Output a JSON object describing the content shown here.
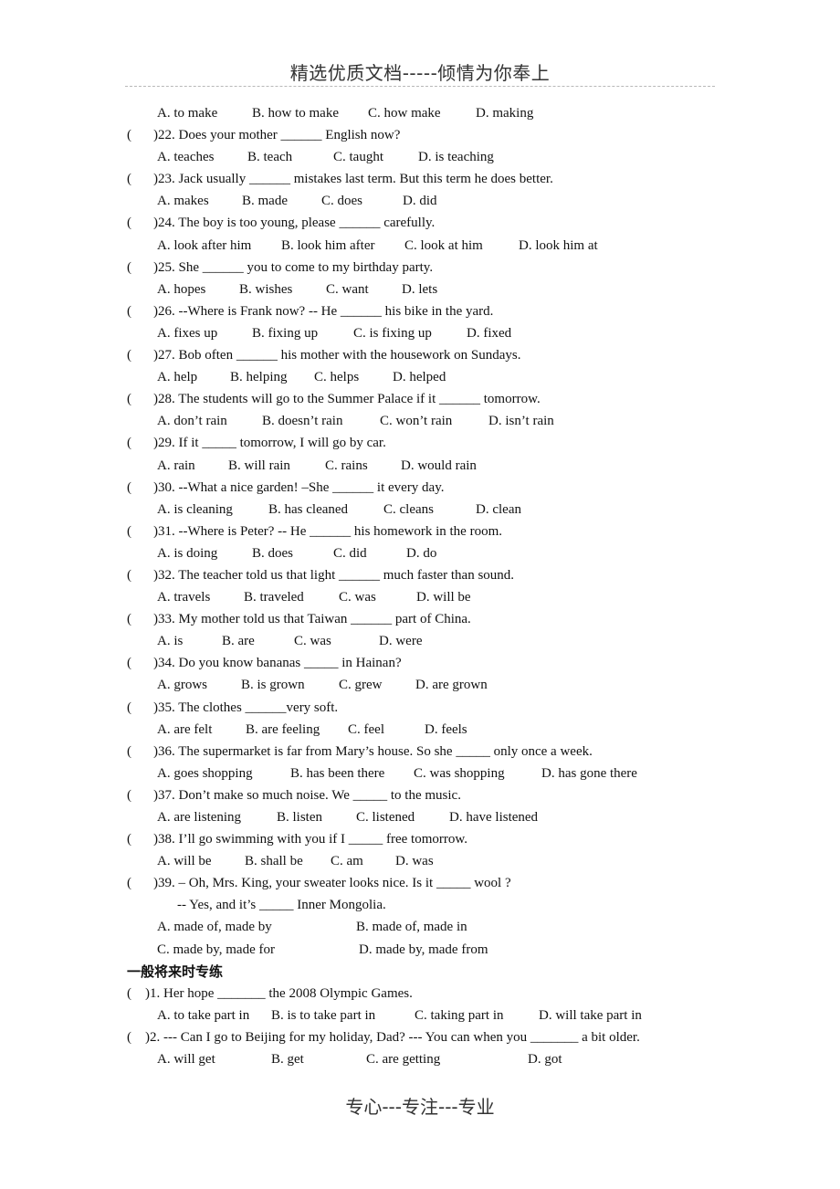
{
  "header": {
    "title": "精选优质文档-----倾情为你奉上"
  },
  "footer": {
    "text": "专心---专注---专业"
  },
  "leading_options": [
    "A. to make",
    "B. how to make",
    "C. how make",
    "D. making"
  ],
  "questions": [
    {
      "num": "22",
      "text": ")22. Does your mother   ______ English now?",
      "options": [
        "A. teaches",
        "B. teach",
        "C. taught",
        "D. is teaching"
      ]
    },
    {
      "num": "23",
      "text": ")23. Jack usually ______ mistakes last term. But this term he does better.",
      "options": [
        "A. makes",
        "B. made",
        "C. does",
        "D. did"
      ]
    },
    {
      "num": "24",
      "text": ")24. The boy is too young, please ______ carefully.",
      "options": [
        "A. look after him",
        "B. look him after",
        "C. look at him",
        "D. look him at"
      ]
    },
    {
      "num": "25",
      "text": ")25. She ______ you to come to my birthday party.",
      "options": [
        "A. hopes",
        "B. wishes",
        "C. want",
        "D. lets"
      ]
    },
    {
      "num": "26",
      "text": ")26. --Where is Frank now?    -- He ______ his bike in the yard.",
      "options": [
        "A. fixes up",
        "B. fixing up",
        "C. is fixing up",
        "D. fixed"
      ]
    },
    {
      "num": "27",
      "text": ")27. Bob often ______ his mother with the housework on Sundays.",
      "options": [
        "A. help",
        "B. helping",
        "C. helps",
        "D. helped"
      ]
    },
    {
      "num": "28",
      "text": ")28. The students will go to the Summer Palace if it ______ tomorrow.",
      "options": [
        "A. don’t rain",
        "B. doesn’t rain",
        "C. won’t rain",
        "D. isn’t rain"
      ]
    },
    {
      "num": "29",
      "text": ")29. If it _____ tomorrow, I will go by car.",
      "options": [
        "A. rain",
        "B. will rain",
        "C. rains",
        "D. would rain"
      ]
    },
    {
      "num": "30",
      "text": ")30. --What a nice garden! –She ______ it every day.",
      "options": [
        "A. is cleaning",
        "B. has cleaned",
        "C. cleans",
        "D. clean"
      ]
    },
    {
      "num": "31",
      "text": ")31. --Where is Peter?    -- He ______ his homework in the room.",
      "options": [
        "A. is doing",
        "B. does",
        "C. did",
        "D. do"
      ]
    },
    {
      "num": "32",
      "text": ")32. The teacher told us that light ______ much faster than sound.",
      "options": [
        "A. travels",
        "B. traveled",
        "C. was",
        "D. will be"
      ]
    },
    {
      "num": "33",
      "text": ")33. My mother told us that Taiwan ______ part of China.",
      "options": [
        "A. is",
        "B. are",
        "C. was",
        "D. were"
      ]
    },
    {
      "num": "34",
      "text": ")34. Do you know bananas _____ in Hainan?",
      "options": [
        "A. grows",
        "B. is grown",
        "C. grew",
        "D. are grown"
      ]
    },
    {
      "num": "35",
      "text": ")35. The clothes ______very soft.",
      "options": [
        "A. are felt",
        "B. are feeling",
        "C. feel",
        "D. feels"
      ]
    },
    {
      "num": "36",
      "text": ")36. The supermarket is far from Mary’s house. So she _____ only once a week.",
      "options": [
        "A. goes shopping",
        "B. has been there",
        "C. was shopping",
        "D. has gone there"
      ]
    },
    {
      "num": "37",
      "text": ")37. Don’t make so much noise. We _____ to the music.",
      "options": [
        "A. are listening",
        "B. listen",
        "C. listened",
        "D. have listened"
      ]
    },
    {
      "num": "38",
      "text": ")38. I’ll go swimming with you if I _____ free tomorrow.",
      "options": [
        "A. will be",
        "B. shall be",
        "C. am",
        "D. was"
      ]
    },
    {
      "num": "39",
      "text": ")39. – Oh, Mrs. King, your sweater    looks nice. Is it _____ wool ?",
      "text2": "-- Yes, and it’s _____ Inner Mongolia.",
      "options": [
        "A. made of, made by",
        "B. made of, made in",
        "C. made by, made for",
        "D. made by, made from"
      ]
    }
  ],
  "section2": {
    "title": "一般将来时专练",
    "questions": [
      {
        "num": "1",
        "text": ")1. Her hope _______ the 2008 Olympic Games.",
        "options": [
          "A. to take part in",
          "B. is to take part in",
          "C. taking part in",
          "D. will take part in"
        ]
      },
      {
        "num": "2",
        "text": ")2. --- Can I go to Beijing for my holiday, Dad? --- You can when you _______ a bit older.",
        "options": [
          "A. will get",
          "B. get",
          "C. are getting",
          "D. got"
        ]
      }
    ]
  },
  "paren_open": "("
}
